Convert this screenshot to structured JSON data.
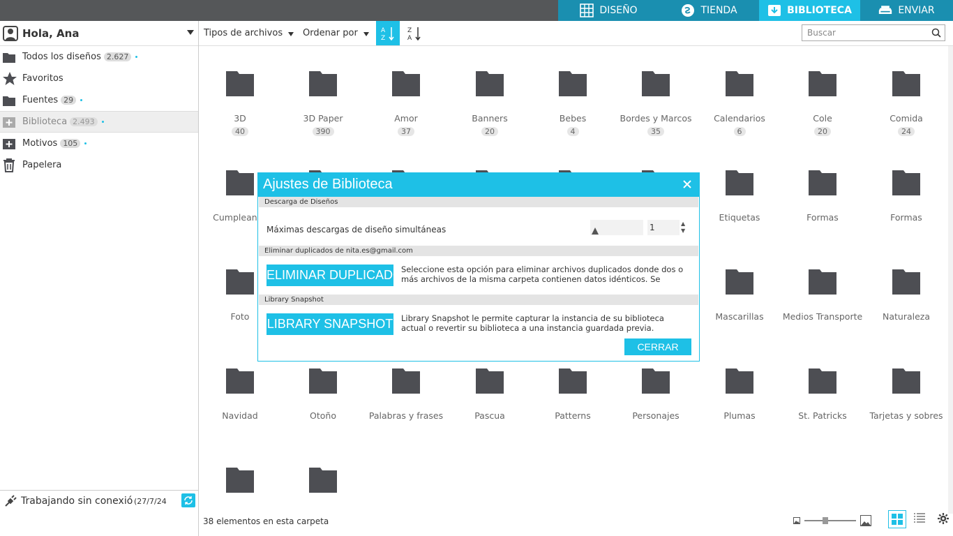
{
  "topnav": {
    "design": "DISEÑO",
    "store": "TIENDA",
    "library": "BIBLIOTECA",
    "send": "ENVIAR"
  },
  "sidebar": {
    "user": "Hola, Ana",
    "items": [
      {
        "label": "Todos los diseños",
        "count": "2.627"
      },
      {
        "label": "Favoritos",
        "count": ""
      },
      {
        "label": "Fuentes",
        "count": "29"
      },
      {
        "label": "Biblioteca",
        "count": "2.493"
      },
      {
        "label": "Motivos",
        "count": "105"
      },
      {
        "label": "Papelera",
        "count": ""
      }
    ],
    "offline": "Trabajando sin conexión",
    "offline_date": "(27/7/24"
  },
  "toolbar": {
    "file_types": "Tipos de archivos",
    "sort_by": "Ordenar por",
    "search_placeholder": "Buscar"
  },
  "folders": [
    {
      "name": "3D",
      "count": "40"
    },
    {
      "name": "3D Paper",
      "count": "390"
    },
    {
      "name": "Amor",
      "count": "37"
    },
    {
      "name": "Banners",
      "count": "20"
    },
    {
      "name": "Bebes",
      "count": "4"
    },
    {
      "name": "Bordes y Marcos",
      "count": "35"
    },
    {
      "name": "Calendarios",
      "count": "6"
    },
    {
      "name": "Cole",
      "count": "20"
    },
    {
      "name": "Comida",
      "count": "24"
    },
    {
      "name": "Cumpleanos",
      "count": ""
    },
    {
      "name": "",
      "count": ""
    },
    {
      "name": "",
      "count": ""
    },
    {
      "name": "",
      "count": ""
    },
    {
      "name": "",
      "count": ""
    },
    {
      "name": "",
      "count": ""
    },
    {
      "name": "Etiquetas",
      "count": ""
    },
    {
      "name": "Formas",
      "count": ""
    },
    {
      "name": "Formas",
      "count": ""
    },
    {
      "name": "Foto",
      "count": ""
    },
    {
      "name": "",
      "count": ""
    },
    {
      "name": "",
      "count": ""
    },
    {
      "name": "",
      "count": ""
    },
    {
      "name": "",
      "count": ""
    },
    {
      "name": "",
      "count": ""
    },
    {
      "name": "Mascarillas",
      "count": ""
    },
    {
      "name": "Medios Transporte",
      "count": ""
    },
    {
      "name": "Naturaleza",
      "count": ""
    },
    {
      "name": "Navidad",
      "count": ""
    },
    {
      "name": "Otoño",
      "count": ""
    },
    {
      "name": "Palabras y frases",
      "count": ""
    },
    {
      "name": "Pascua",
      "count": ""
    },
    {
      "name": "Patterns",
      "count": ""
    },
    {
      "name": "Personajes",
      "count": ""
    },
    {
      "name": "Plumas",
      "count": ""
    },
    {
      "name": "St. Patricks",
      "count": ""
    },
    {
      "name": "Tarjetas y sobres",
      "count": ""
    },
    {
      "name": "",
      "count": ""
    },
    {
      "name": "",
      "count": ""
    }
  ],
  "statusbar": {
    "count_text": "38 elementos en esta carpeta"
  },
  "modal": {
    "title": "Ajustes de Biblioteca",
    "section_download": "Descarga de Diseños",
    "max_downloads_label": "Máximas descargas de diseño simultáneas",
    "max_downloads_value": "1",
    "section_duplicates": "Eliminar duplicados de nita.es@gmail.com",
    "dup_button": "ELIMINAR DUPLICADOS",
    "dup_desc": "Seleccione esta opción para eliminar archivos duplicados donde dos o más archivos de la misma carpeta contienen datos idénticos. Se",
    "section_snapshot": "Library Snapshot",
    "snap_button": "LIBRARY SNAPSHOT",
    "snap_desc": "Library Snapshot le permite capturar la instancia de su biblioteca actual o revertir su biblioteca a una instancia guardada previa.",
    "close_button": "CERRAR"
  },
  "colors": {
    "accent": "#1ec0e6",
    "topbar": "#555759",
    "folder": "#4d4e53"
  }
}
